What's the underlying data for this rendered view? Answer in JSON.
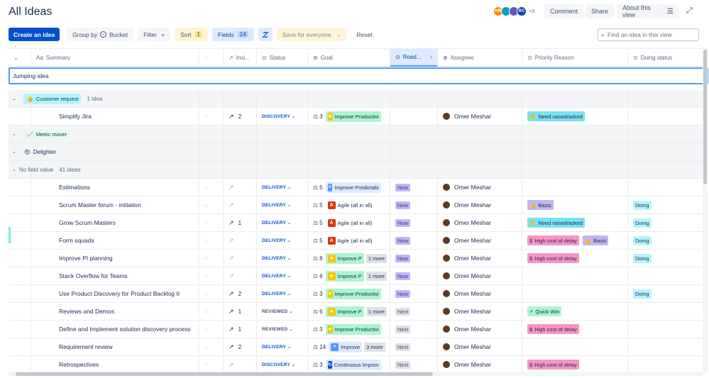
{
  "header": {
    "title": "All Ideas",
    "avatars": [
      {
        "initials": "HR",
        "color": "#ff8b00"
      },
      {
        "initials": "",
        "color": "#00a3bf"
      },
      {
        "initials": "",
        "color": "#6554c0"
      },
      {
        "initials": "RC",
        "color": "#0747a6"
      }
    ],
    "avatars_more": "+3",
    "comment": "Comment",
    "share": "Share",
    "about": "About this view"
  },
  "toolbar": {
    "create": "Create an idea",
    "group_by": "Group by",
    "group_value": "Bucket",
    "filter": "Filter",
    "filter_plus": "+",
    "sort": "Sort",
    "sort_count": "1",
    "fields": "Fields",
    "fields_count": "14",
    "save": "Save for everyone",
    "reset": "Reset",
    "search_placeholder": "Find an idea in this view"
  },
  "columns": {
    "summary": "Summary",
    "insights": "Insi...",
    "status": "Status",
    "goal": "Goal",
    "roadmap": "Road...",
    "assignee": "Assignee",
    "priority": "Priority Reason",
    "doing": "Doing status"
  },
  "new_idea_input": "Jumping idea",
  "groups": [
    {
      "label": "Customer request",
      "emoji": "👍",
      "count": "1 idea"
    },
    {
      "label": "Metric mover",
      "emoji": "📈",
      "count": ""
    },
    {
      "label": "Delighter",
      "emoji": "😍",
      "count": ""
    },
    {
      "label": "No field value",
      "count": "41 ideas"
    }
  ],
  "rows": [
    {
      "summary": "Simplify Jira",
      "insights": "2",
      "status": "DISCOVERY",
      "goal_num": "3",
      "goal": "Improve Productivi",
      "goal_more": "",
      "roadmap": "",
      "assignee": "Omer Meshar",
      "priority": [
        "Need raised/asked"
      ],
      "doing": ""
    },
    {
      "summary": "Estimations",
      "insights": "",
      "status": "DELIVERY",
      "goal_num": "5",
      "goal": "Improve Predictabi",
      "goal_more": "",
      "roadmap": "Now",
      "assignee": "Omer Meshar",
      "priority": [],
      "doing": ""
    },
    {
      "summary": "Scrum Master forum - initiation",
      "insights": "",
      "status": "DELIVERY",
      "goal_num": "5",
      "goal": "Agile (all in all)",
      "goal_more": "",
      "roadmap": "Now",
      "assignee": "Omer Meshar",
      "priority": [
        "Basis"
      ],
      "doing": "Doing"
    },
    {
      "summary": "Grow Scrum Masters",
      "insights": "1",
      "status": "DELIVERY",
      "goal_num": "5",
      "goal": "Agile (all in all)",
      "goal_more": "",
      "roadmap": "Now",
      "assignee": "Omer Meshar",
      "priority": [
        "Need raised/asked"
      ],
      "doing": "Doing"
    },
    {
      "summary": "Form squads",
      "insights": "",
      "status": "DELIVERY",
      "goal_num": "5",
      "goal": "Agile (all in all)",
      "goal_more": "",
      "roadmap": "Now",
      "assignee": "Omer Meshar",
      "priority": [
        "High cost of delay",
        "Basis"
      ],
      "doing": "Doing"
    },
    {
      "summary": "Improve PI planning",
      "insights": "",
      "status": "DELIVERY",
      "goal_num": "8",
      "goal": "Improve P",
      "goal_more": "1 more",
      "roadmap": "Now",
      "assignee": "Omer Meshar",
      "priority": [
        "High cost of delay"
      ],
      "doing": "Doing"
    },
    {
      "summary": "Stack Overflow for Teams",
      "insights": "",
      "status": "DELIVERY",
      "goal_num": "6",
      "goal": "Improve P",
      "goal_more": "1 more",
      "roadmap": "Now",
      "assignee": "Omer Meshar",
      "priority": [],
      "doing": ""
    },
    {
      "summary": "Use Product Discovery for Product Backlog II",
      "insights": "2",
      "status": "DELIVERY",
      "goal_num": "3",
      "goal": "Improve Productivi",
      "goal_more": "",
      "roadmap": "Now",
      "assignee": "Omer Meshar",
      "priority": [],
      "doing": "Doing"
    },
    {
      "summary": "Reviews and Demos",
      "insights": "1",
      "status": "REVIEWED",
      "goal_num": "6",
      "goal": "Improve P",
      "goal_more": "1 more",
      "roadmap": "Next",
      "assignee": "Omer Meshar",
      "priority": [
        "Quick Win"
      ],
      "doing": ""
    },
    {
      "summary": "Define and Implement solution discovery process",
      "insights": "1",
      "status": "REVIEWED",
      "goal_num": "3",
      "goal": "Improve Productivi",
      "goal_more": "",
      "roadmap": "Next",
      "assignee": "Omer Meshar",
      "priority": [
        "High cost of delay"
      ],
      "doing": ""
    },
    {
      "summary": "Requirement review",
      "insights": "2",
      "status": "DELIVERY",
      "goal_num": "14",
      "goal": "Improve",
      "goal_more": "3 more",
      "roadmap": "Next",
      "assignee": "Omer Meshar",
      "priority": [],
      "doing": ""
    },
    {
      "summary": "Retrospectives",
      "insights": "",
      "status": "DISCOVERY",
      "goal_num": "3",
      "goal": "Continuous Improv",
      "goal_more": "",
      "roadmap": "Next",
      "assignee": "Omer Meshar",
      "priority": [
        "High cost of delay"
      ],
      "doing": ""
    }
  ]
}
